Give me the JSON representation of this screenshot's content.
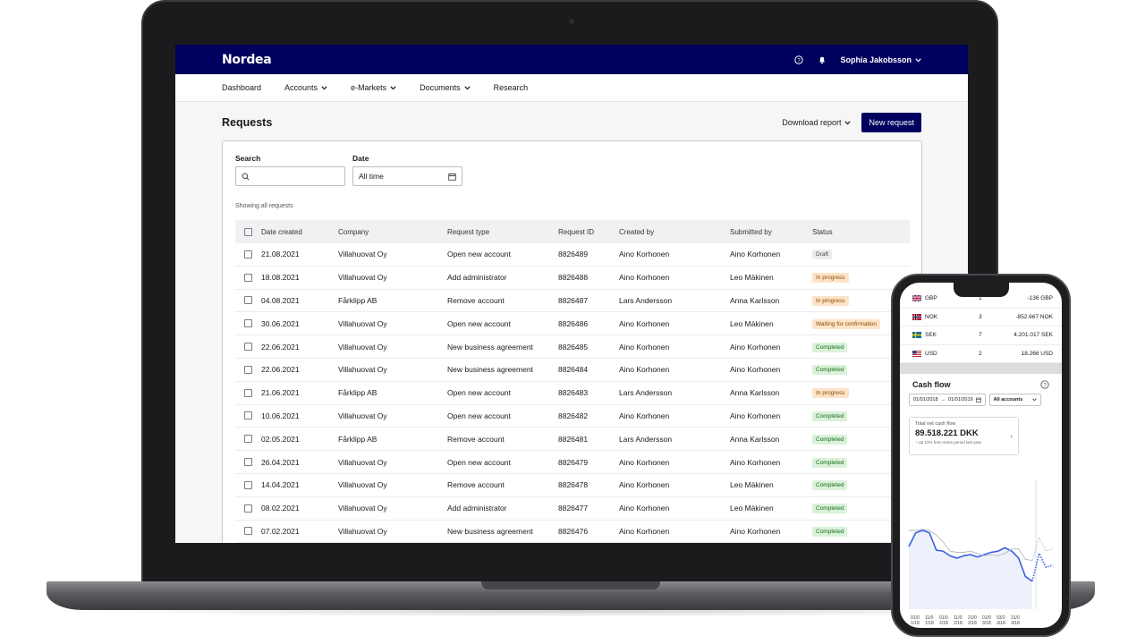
{
  "app": {
    "logo": "Nordea",
    "user_name": "Sophia Jakobsson",
    "nav": [
      "Dashboard",
      "Accounts",
      "e-Markets",
      "Documents",
      "Research"
    ],
    "nav_has_dropdown": [
      false,
      true,
      true,
      true,
      false
    ]
  },
  "page": {
    "title": "Requests",
    "download_label": "Download report",
    "new_request_label": "New request"
  },
  "filters": {
    "search_label": "Search",
    "search_value": "",
    "date_label": "Date",
    "date_value": "All time",
    "showing": "Showing all requests"
  },
  "table": {
    "headers": [
      "Date created",
      "Company",
      "Request type",
      "Request ID",
      "Created by",
      "Submitted by",
      "Status"
    ],
    "rows": [
      [
        "21.08.2021",
        "Villahuovat Oy",
        "Open new account",
        "8826489",
        "Aino Korhonen",
        "Aino Korhonen",
        "Draft"
      ],
      [
        "18.08.2021",
        "Villahuovat Oy",
        "Add administrator",
        "8826488",
        "Aino Korhonen",
        "Leo Mäkinen",
        "In progress"
      ],
      [
        "04.08.2021",
        "Fårklipp AB",
        "Remove account",
        "8826487",
        "Lars Andersson",
        "Anna Karlsson",
        "In progress"
      ],
      [
        "30.06.2021",
        "Villahuovat Oy",
        "Open new account",
        "8826486",
        "Aino Korhonen",
        "Leo Mäkinen",
        "Waiting for confirmation"
      ],
      [
        "22.06.2021",
        "Villahuovat Oy",
        "New business agreement",
        "8826485",
        "Aino Korhonen",
        "Aino Korhonen",
        "Completed"
      ],
      [
        "22.06.2021",
        "Villahuovat Oy",
        "New business agreement",
        "8826484",
        "Aino Korhonen",
        "Aino Korhonen",
        "Completed"
      ],
      [
        "21.06.2021",
        "Fårklipp AB",
        "Open new account",
        "8826483",
        "Lars Andersson",
        "Anna Karlsson",
        "In progress"
      ],
      [
        "10.06.2021",
        "Villahuovat Oy",
        "Open new account",
        "8826482",
        "Aino Korhonen",
        "Aino Korhonen",
        "Completed"
      ],
      [
        "02.05.2021",
        "Fårklipp AB",
        "Remove account",
        "8826481",
        "Lars Andersson",
        "Anna Karlsson",
        "Completed"
      ],
      [
        "26.04.2021",
        "Villahuovat Oy",
        "Open new account",
        "8826479",
        "Aino Korhonen",
        "Aino Korhonen",
        "Completed"
      ],
      [
        "14.04.2021",
        "Villahuovat Oy",
        "Remove account",
        "8826478",
        "Aino Korhonen",
        "Leo Mäkinen",
        "Completed"
      ],
      [
        "08.02.2021",
        "Villahuovat Oy",
        "Add administrator",
        "8826477",
        "Aino Korhonen",
        "Leo Mäkinen",
        "Completed"
      ],
      [
        "07.02.2021",
        "Villahuovat Oy",
        "New business agreement",
        "8826476",
        "Aino Korhonen",
        "Aino Korhonen",
        "Completed"
      ]
    ]
  },
  "status_colors": {
    "Draft": {
      "bg": "#ececef",
      "fg": "#444444"
    },
    "In progress": {
      "bg": "#fde3c8",
      "fg": "#8a4b00"
    },
    "Waiting for confirmation": {
      "bg": "#fde3c8",
      "fg": "#8a4b00"
    },
    "Completed": {
      "bg": "#d9f2d9",
      "fg": "#1e6b1e"
    }
  },
  "colors": {
    "brand": "#00005e",
    "chart_line": "#3a5fe0",
    "chart_compare": "#b9b9bd"
  },
  "mobile": {
    "currencies": [
      {
        "flag": "gb-flag",
        "code": "GBP",
        "count": "1",
        "amount": "-136 GBP"
      },
      {
        "flag": "no-flag",
        "code": "NOK",
        "count": "3",
        "amount": "-852.667 NOK"
      },
      {
        "flag": "se-flag",
        "code": "SEK",
        "count": "7",
        "amount": "4.201.017 SEK"
      },
      {
        "flag": "us-flag",
        "code": "USD",
        "count": "2",
        "amount": "18.266 USD"
      }
    ],
    "cash_flow_title": "Cash flow",
    "date_range_from": "01/01/2018",
    "date_range_to": "01/01/2019",
    "accounts_filter": "All accounts",
    "total_label": "Total net cash flow",
    "total_value": "89.518.221 DKK",
    "total_note": "Up 12% from same period last year",
    "x_ticks": [
      "01/0 1/18",
      "11/0 1/18",
      "01/0 2/18",
      "11/0 2/18",
      "21/0 2/18",
      "01/0 3/18",
      "03/2 3/18",
      "31/0 3/18"
    ]
  },
  "chart_data": {
    "type": "line",
    "series": [
      {
        "values": [
          62,
          62,
          63,
          62,
          58,
          52,
          44,
          43,
          43,
          44,
          42,
          40,
          41,
          40,
          42,
          46,
          46,
          37,
          36,
          56,
          44,
          46
        ]
      },
      {
        "values": [
          48,
          60,
          62,
          60,
          45,
          44,
          40,
          38,
          40,
          41,
          39,
          41,
          43,
          44,
          47,
          44,
          38,
          22,
          18,
          42,
          30,
          32
        ]
      }
    ],
    "ylim": [
      0,
      100
    ]
  }
}
